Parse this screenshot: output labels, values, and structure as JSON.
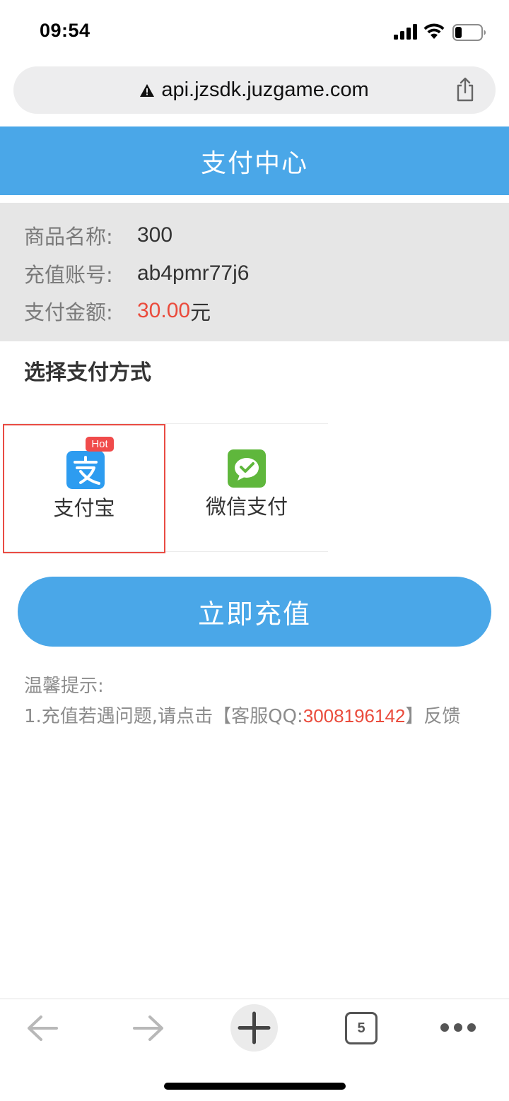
{
  "status_bar": {
    "time": "09:54"
  },
  "browser": {
    "url": "api.jzsdk.juzgame.com",
    "tab_count": "5"
  },
  "header": {
    "title": "支付中心"
  },
  "order": {
    "product_label": "商品名称:",
    "product_value": "300",
    "account_label": "充值账号:",
    "account_value": "ab4pmr77j6",
    "amount_label": "支付金额:",
    "amount_value": "30.00",
    "amount_unit": "元"
  },
  "payment": {
    "section_title": "选择支付方式",
    "methods": [
      {
        "label": "支付宝",
        "badge": "Hot",
        "selected": true
      },
      {
        "label": "微信支付",
        "selected": false
      }
    ]
  },
  "actions": {
    "recharge_label": "立即充值"
  },
  "tips": {
    "title": "温馨提示:",
    "line_prefix": "1.充值若遇问题,请点击【客服QQ:",
    "qq_number": "3008196142",
    "line_suffix": "】反馈"
  },
  "colors": {
    "accent": "#4aa7e8",
    "highlight": "#ea4b3c",
    "alipay": "#2d9cf0",
    "wechat": "#5fb73c"
  }
}
